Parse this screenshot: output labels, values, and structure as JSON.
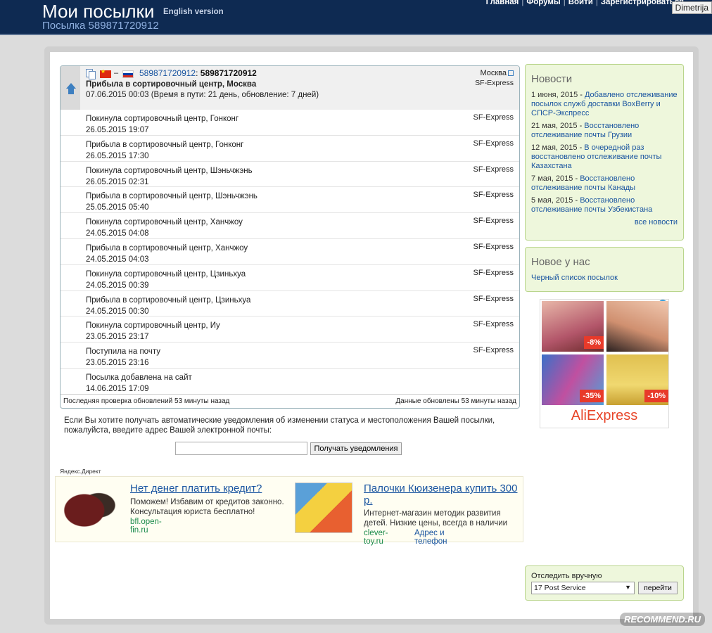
{
  "header": {
    "title": "Мои посылки",
    "english_link": "English version",
    "subtitle": "Посылка 589871720912",
    "nav": [
      "Главная",
      "Форумы",
      "Войти",
      "Зарегистрироваться"
    ],
    "user": "Dimetrija"
  },
  "tracking": {
    "number_link": "589871720912",
    "number_bold": "589871720912",
    "dash": "–",
    "current_status": "Прибыла в сортировочный центр, Москва",
    "current_date": "07.06.2015 00:03 (Время в пути: 21 день, обновление: 7 дней)",
    "current_city": "Москва",
    "current_carrier": "SF-Express",
    "events": [
      {
        "status": "Покинула сортировочный центр, Гонконг",
        "date": "26.05.2015 19:07",
        "carrier": "SF-Express"
      },
      {
        "status": "Прибыла в сортировочный центр, Гонконг",
        "date": "26.05.2015 17:30",
        "carrier": "SF-Express"
      },
      {
        "status": "Покинула сортировочный центр, Шэньчжэнь",
        "date": "26.05.2015 02:31",
        "carrier": "SF-Express"
      },
      {
        "status": "Прибыла в сортировочный центр, Шэньчжэнь",
        "date": "25.05.2015 05:40",
        "carrier": "SF-Express"
      },
      {
        "status": "Покинула сортировочный центр, Ханчжоу",
        "date": "24.05.2015 04:08",
        "carrier": "SF-Express"
      },
      {
        "status": "Прибыла в сортировочный центр, Ханчжоу",
        "date": "24.05.2015 04:03",
        "carrier": "SF-Express"
      },
      {
        "status": "Покинула сортировочный центр, Цзиньхуа",
        "date": "24.05.2015 00:39",
        "carrier": "SF-Express"
      },
      {
        "status": "Прибыла в сортировочный центр, Цзиньхуа",
        "date": "24.05.2015 00:30",
        "carrier": "SF-Express"
      },
      {
        "status": "Покинула сортировочный центр, Иу",
        "date": "23.05.2015 23:17",
        "carrier": "SF-Express"
      },
      {
        "status": "Поступила на почту",
        "date": "23.05.2015 23:16",
        "carrier": "SF-Express"
      },
      {
        "status": "Посылка добавлена на сайт",
        "date": "14.06.2015 17:09",
        "carrier": ""
      }
    ],
    "footer_left": "Последняя проверка обновлений 53 минуты назад",
    "footer_right": "Данные обновлены 53 минуты назад"
  },
  "notify": {
    "text": "Если Вы хотите получать автоматические уведомления об изменении статуса и местоположения Вашей посылки, пожалуйста, введите адрес Вашей электронной почты:",
    "email_value": "",
    "button": "Получать уведомления"
  },
  "direct": {
    "label": "Яндекс.Директ",
    "ads": [
      {
        "title": "Нет денег платить кредит?",
        "body": "Поможем! Избавим от кредитов законно. Консультация юриста бесплатно!",
        "link": "bfl.open-fin.ru",
        "extra": ""
      },
      {
        "title": "Палочки Кюизенера купить 300 р.",
        "body": "Интернет-магазин методик развития детей. Низкие цены, всегда в наличии",
        "link": "clever-toy.ru",
        "extra": "Адрес и телефон"
      }
    ]
  },
  "news": {
    "title": "Новости",
    "items": [
      {
        "date": "1 июня, 2015",
        "text": "Добавлено отслеживание посылок служб доставки BoxBerry и СПСР-Экспресс"
      },
      {
        "date": "21 мая, 2015",
        "text": "Восстановлено отслеживание почты Грузии"
      },
      {
        "date": "12 мая, 2015",
        "text": "В очередной раз восстановлено отслеживание почты Казахстана"
      },
      {
        "date": "7 мая, 2015",
        "text": "Восстановлено отслеживание почты Канады"
      },
      {
        "date": "5 мая, 2015",
        "text": "Восстановлено отслеживание почты Узбекистана"
      }
    ],
    "all_link": "все новости"
  },
  "new_with_us": {
    "title": "Новое у нас",
    "link": "Черный список посылок"
  },
  "aliexpress": {
    "badges": [
      "-8%",
      "-35%",
      "-10%"
    ],
    "logo": "AliExpress",
    "info": "i",
    "close": "✕"
  },
  "manual": {
    "label": "Отследить вручную",
    "selected": "17 Post Service",
    "button": "перейти"
  },
  "watermark": "RECOMMEND.RU",
  "colors": {
    "header_bg": "#0e2a52",
    "link": "#1a55a0",
    "sidebar_bg": "#eef7dc",
    "sidebar_border": "#b9d58c"
  }
}
